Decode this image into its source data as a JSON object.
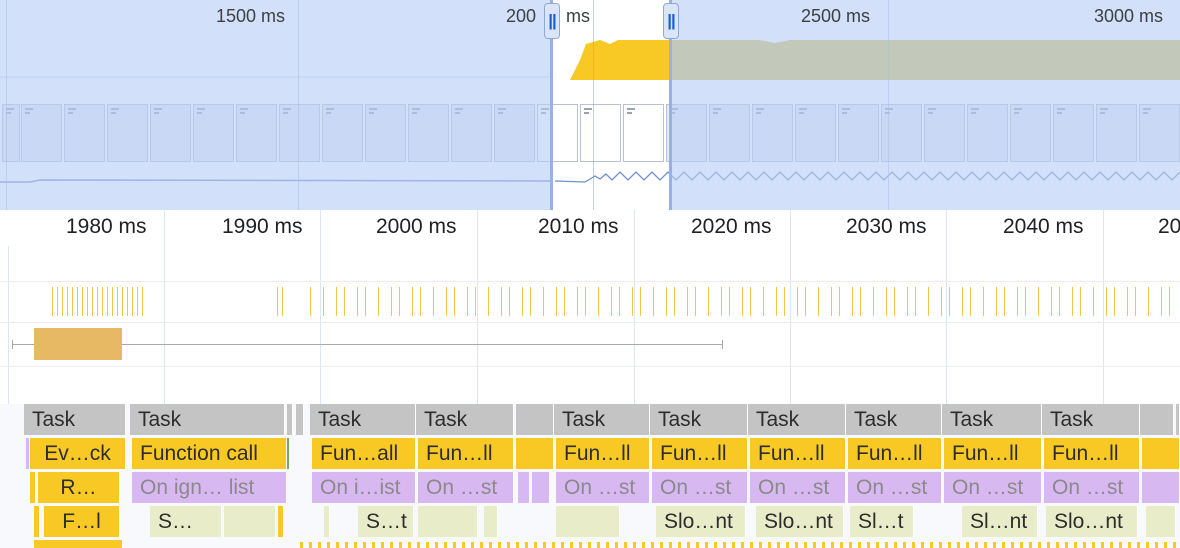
{
  "overview": {
    "tick_labels": [
      "1500 ms",
      "200",
      "ms",
      "2500 ms",
      "3000 ms"
    ],
    "handle_glyph": "||"
  },
  "ruler": {
    "tick_labels": [
      "1980 ms",
      "1990 ms",
      "2000 ms",
      "2010 ms",
      "2020 ms",
      "2030 ms",
      "2040 ms",
      "20"
    ]
  },
  "flame": {
    "row1": [
      "Task",
      "Task",
      "Task",
      "Task",
      "Task",
      "Task",
      "Task",
      "Task",
      "Task",
      "Task"
    ],
    "row2": [
      "Ev…ck",
      "Function call",
      "Fun…all",
      "Fun…ll",
      "Fun…ll",
      "Fun…ll",
      "Fun…ll",
      "Fun…ll",
      "Fun…ll",
      "Fun…ll"
    ],
    "row3": [
      "R…",
      "On ign… list",
      "On i…ist",
      "On …st",
      "On …st",
      "On …st",
      "On …st",
      "On …st",
      "On …st",
      "On …st"
    ],
    "row4": [
      "F…l",
      "S…",
      "S…t",
      "Slo…nt",
      "Slo…nt",
      "Sl…t",
      "Sl…nt",
      "Slo…nt"
    ]
  },
  "colors": {
    "task": "#c4c4c4",
    "function_call": "#f8c924",
    "purple": "#d8b8f0",
    "sage": "#e9ecc8",
    "selection": "#b7cdf6",
    "cpu_area": "#d4c259"
  }
}
